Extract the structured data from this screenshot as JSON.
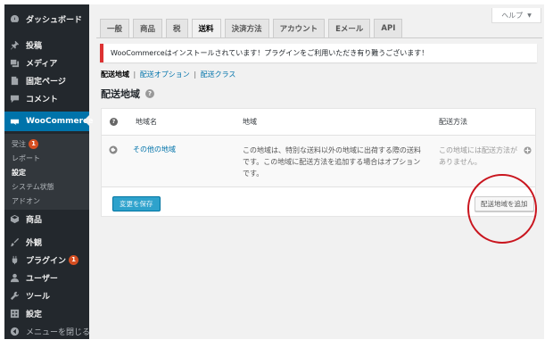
{
  "sidebar": {
    "items": [
      {
        "label": "ダッシュボード",
        "icon": "dashboard-icon"
      },
      {
        "label": "投稿",
        "icon": "pin-icon"
      },
      {
        "label": "メディア",
        "icon": "media-icon"
      },
      {
        "label": "固定ページ",
        "icon": "page-icon"
      },
      {
        "label": "コメント",
        "icon": "comment-icon"
      },
      {
        "label": "WooCommerce",
        "icon": "woocommerce-icon"
      },
      {
        "label": "商品",
        "icon": "product-icon"
      },
      {
        "label": "外観",
        "icon": "brush-icon"
      },
      {
        "label": "プラグイン",
        "icon": "plugin-icon",
        "badge": "1"
      },
      {
        "label": "ユーザー",
        "icon": "user-icon"
      },
      {
        "label": "ツール",
        "icon": "wrench-icon"
      },
      {
        "label": "設定",
        "icon": "settings-icon"
      },
      {
        "label": "メニューを閉じる",
        "icon": "collapse-icon"
      }
    ],
    "submenu": [
      {
        "label": "受注",
        "badge": "1"
      },
      {
        "label": "レポート"
      },
      {
        "label": "設定"
      },
      {
        "label": "システム状態"
      },
      {
        "label": "アドオン"
      }
    ]
  },
  "help": {
    "label": "ヘルプ"
  },
  "tabs": [
    "一般",
    "商品",
    "税",
    "送料",
    "決済方法",
    "アカウント",
    "Eメール",
    "API"
  ],
  "notice": {
    "text": "WooCommerceはインストールされています！プラグインをご利用いただき有り難うございます！"
  },
  "subsubsub": {
    "current": "配送地域",
    "links": [
      "配送オプション",
      "配送クラス"
    ],
    "separator": "|"
  },
  "zones": {
    "title": "配送地域",
    "help_glyph": "?",
    "columns": {
      "name": "地域名",
      "region": "地域",
      "methods": "配送方法"
    },
    "rows": [
      {
        "name": "その他の地域",
        "description": "この地域は、特別な送料以外の地域に出荷する際の送料です。この地域に配送方法を追加する場合はオプションです。",
        "methods": "この地域には配送方法がありません。"
      }
    ],
    "save_label": "変更を保存",
    "add_zone_label": "配送地域を追加"
  },
  "colors": {
    "sidebar_bg": "#23282d",
    "accent": "#0073aa",
    "badge": "#d54e21",
    "notice_border": "#dc3232",
    "annotation_circle": "#c9151e"
  }
}
